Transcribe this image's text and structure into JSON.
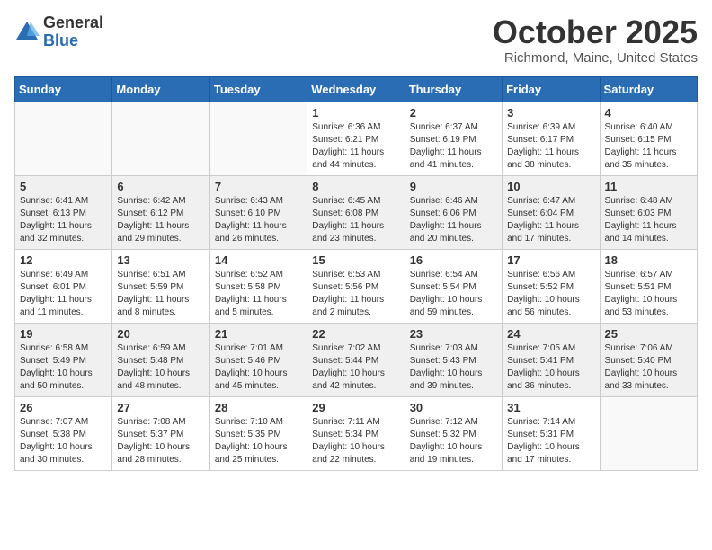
{
  "header": {
    "logo_general": "General",
    "logo_blue": "Blue",
    "month_title": "October 2025",
    "location": "Richmond, Maine, United States"
  },
  "days_of_week": [
    "Sunday",
    "Monday",
    "Tuesday",
    "Wednesday",
    "Thursday",
    "Friday",
    "Saturday"
  ],
  "weeks": [
    [
      {
        "day": "",
        "info": ""
      },
      {
        "day": "",
        "info": ""
      },
      {
        "day": "",
        "info": ""
      },
      {
        "day": "1",
        "info": "Sunrise: 6:36 AM\nSunset: 6:21 PM\nDaylight: 11 hours\nand 44 minutes."
      },
      {
        "day": "2",
        "info": "Sunrise: 6:37 AM\nSunset: 6:19 PM\nDaylight: 11 hours\nand 41 minutes."
      },
      {
        "day": "3",
        "info": "Sunrise: 6:39 AM\nSunset: 6:17 PM\nDaylight: 11 hours\nand 38 minutes."
      },
      {
        "day": "4",
        "info": "Sunrise: 6:40 AM\nSunset: 6:15 PM\nDaylight: 11 hours\nand 35 minutes."
      }
    ],
    [
      {
        "day": "5",
        "info": "Sunrise: 6:41 AM\nSunset: 6:13 PM\nDaylight: 11 hours\nand 32 minutes."
      },
      {
        "day": "6",
        "info": "Sunrise: 6:42 AM\nSunset: 6:12 PM\nDaylight: 11 hours\nand 29 minutes."
      },
      {
        "day": "7",
        "info": "Sunrise: 6:43 AM\nSunset: 6:10 PM\nDaylight: 11 hours\nand 26 minutes."
      },
      {
        "day": "8",
        "info": "Sunrise: 6:45 AM\nSunset: 6:08 PM\nDaylight: 11 hours\nand 23 minutes."
      },
      {
        "day": "9",
        "info": "Sunrise: 6:46 AM\nSunset: 6:06 PM\nDaylight: 11 hours\nand 20 minutes."
      },
      {
        "day": "10",
        "info": "Sunrise: 6:47 AM\nSunset: 6:04 PM\nDaylight: 11 hours\nand 17 minutes."
      },
      {
        "day": "11",
        "info": "Sunrise: 6:48 AM\nSunset: 6:03 PM\nDaylight: 11 hours\nand 14 minutes."
      }
    ],
    [
      {
        "day": "12",
        "info": "Sunrise: 6:49 AM\nSunset: 6:01 PM\nDaylight: 11 hours\nand 11 minutes."
      },
      {
        "day": "13",
        "info": "Sunrise: 6:51 AM\nSunset: 5:59 PM\nDaylight: 11 hours\nand 8 minutes."
      },
      {
        "day": "14",
        "info": "Sunrise: 6:52 AM\nSunset: 5:58 PM\nDaylight: 11 hours\nand 5 minutes."
      },
      {
        "day": "15",
        "info": "Sunrise: 6:53 AM\nSunset: 5:56 PM\nDaylight: 11 hours\nand 2 minutes."
      },
      {
        "day": "16",
        "info": "Sunrise: 6:54 AM\nSunset: 5:54 PM\nDaylight: 10 hours\nand 59 minutes."
      },
      {
        "day": "17",
        "info": "Sunrise: 6:56 AM\nSunset: 5:52 PM\nDaylight: 10 hours\nand 56 minutes."
      },
      {
        "day": "18",
        "info": "Sunrise: 6:57 AM\nSunset: 5:51 PM\nDaylight: 10 hours\nand 53 minutes."
      }
    ],
    [
      {
        "day": "19",
        "info": "Sunrise: 6:58 AM\nSunset: 5:49 PM\nDaylight: 10 hours\nand 50 minutes."
      },
      {
        "day": "20",
        "info": "Sunrise: 6:59 AM\nSunset: 5:48 PM\nDaylight: 10 hours\nand 48 minutes."
      },
      {
        "day": "21",
        "info": "Sunrise: 7:01 AM\nSunset: 5:46 PM\nDaylight: 10 hours\nand 45 minutes."
      },
      {
        "day": "22",
        "info": "Sunrise: 7:02 AM\nSunset: 5:44 PM\nDaylight: 10 hours\nand 42 minutes."
      },
      {
        "day": "23",
        "info": "Sunrise: 7:03 AM\nSunset: 5:43 PM\nDaylight: 10 hours\nand 39 minutes."
      },
      {
        "day": "24",
        "info": "Sunrise: 7:05 AM\nSunset: 5:41 PM\nDaylight: 10 hours\nand 36 minutes."
      },
      {
        "day": "25",
        "info": "Sunrise: 7:06 AM\nSunset: 5:40 PM\nDaylight: 10 hours\nand 33 minutes."
      }
    ],
    [
      {
        "day": "26",
        "info": "Sunrise: 7:07 AM\nSunset: 5:38 PM\nDaylight: 10 hours\nand 30 minutes."
      },
      {
        "day": "27",
        "info": "Sunrise: 7:08 AM\nSunset: 5:37 PM\nDaylight: 10 hours\nand 28 minutes."
      },
      {
        "day": "28",
        "info": "Sunrise: 7:10 AM\nSunset: 5:35 PM\nDaylight: 10 hours\nand 25 minutes."
      },
      {
        "day": "29",
        "info": "Sunrise: 7:11 AM\nSunset: 5:34 PM\nDaylight: 10 hours\nand 22 minutes."
      },
      {
        "day": "30",
        "info": "Sunrise: 7:12 AM\nSunset: 5:32 PM\nDaylight: 10 hours\nand 19 minutes."
      },
      {
        "day": "31",
        "info": "Sunrise: 7:14 AM\nSunset: 5:31 PM\nDaylight: 10 hours\nand 17 minutes."
      },
      {
        "day": "",
        "info": ""
      }
    ]
  ],
  "shaded_rows": [
    1,
    3
  ]
}
